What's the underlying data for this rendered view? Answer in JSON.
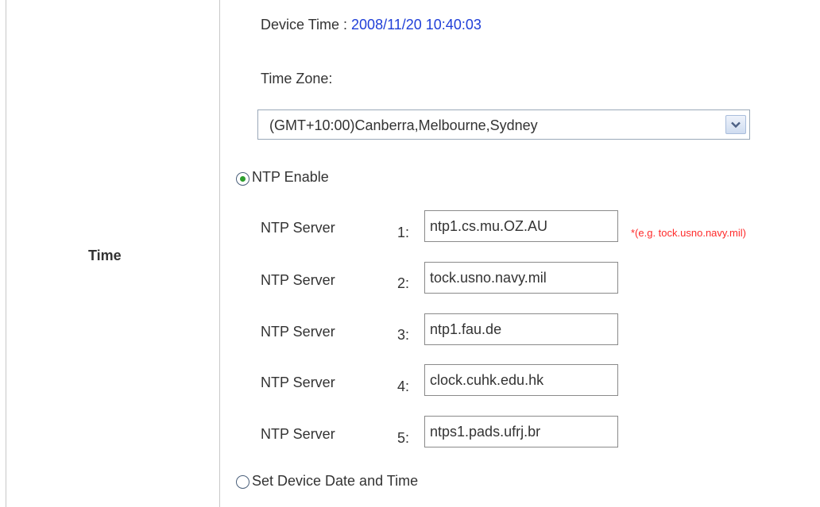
{
  "section": {
    "label": "Time"
  },
  "device_time": {
    "label": "Device Time : ",
    "value": "2008/11/20 10:40:03"
  },
  "time_zone": {
    "label": "Time Zone:",
    "selected": "(GMT+10:00)Canberra,Melbourne,Sydney"
  },
  "ntp_enable": {
    "label": "NTP Enable",
    "checked": true
  },
  "ntp_servers": [
    {
      "label": "NTP Server",
      "index": "1:",
      "value": "ntp1.cs.mu.OZ.AU"
    },
    {
      "label": "NTP Server",
      "index": "2:",
      "value": "tock.usno.navy.mil"
    },
    {
      "label": "NTP Server",
      "index": "3:",
      "value": "ntp1.fau.de"
    },
    {
      "label": "NTP Server",
      "index": "4:",
      "value": "clock.cuhk.edu.hk"
    },
    {
      "label": "NTP Server",
      "index": "5:",
      "value": "ntps1.pads.ufrj.br"
    }
  ],
  "hint": "*(e.g. tock.usno.navy.mil)",
  "set_device_time": {
    "label": "Set Device Date and Time",
    "checked": false
  },
  "colors": {
    "device_time_value": "#1f3fd8",
    "hint": "#ff2a2a",
    "radio_dot": "#2e9e2e"
  }
}
